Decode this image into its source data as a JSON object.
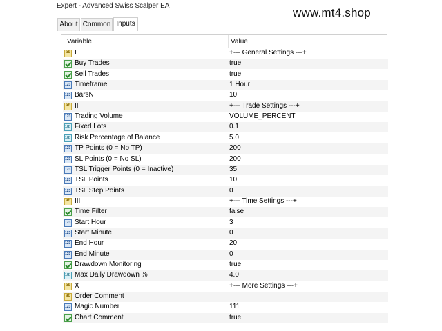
{
  "window": {
    "title": "Expert - Advanced Swiss Scalper EA"
  },
  "watermark": "www.mt4.shop",
  "tabs": [
    {
      "label": "About"
    },
    {
      "label": "Common"
    },
    {
      "label": "Inputs"
    }
  ],
  "table": {
    "headers": {
      "variable": "Variable",
      "value": "Value"
    },
    "rows": [
      {
        "icon": "ab",
        "name": "I",
        "value": "+--- General Settings ---+"
      },
      {
        "icon": "bool",
        "name": "Buy Trades",
        "value": "true"
      },
      {
        "icon": "bool",
        "name": "Sell Trades",
        "value": "true"
      },
      {
        "icon": "int",
        "name": "Timeframe",
        "value": "1 Hour"
      },
      {
        "icon": "int",
        "name": "BarsN",
        "value": "10"
      },
      {
        "icon": "ab",
        "name": "II",
        "value": "+--- Trade Settings ---+"
      },
      {
        "icon": "int",
        "name": "Trading Volume",
        "value": "VOLUME_PERCENT"
      },
      {
        "icon": "dbl",
        "name": "Fixed Lots",
        "value": "0.1"
      },
      {
        "icon": "dbl",
        "name": "Risk Percentage of Balance",
        "value": "5.0"
      },
      {
        "icon": "int",
        "name": "TP Points (0 = No TP)",
        "value": "200"
      },
      {
        "icon": "int",
        "name": "SL Points (0 = No SL)",
        "value": "200"
      },
      {
        "icon": "int",
        "name": "TSL Trigger Points (0 = Inactive)",
        "value": "35"
      },
      {
        "icon": "int",
        "name": "TSL Points",
        "value": "10"
      },
      {
        "icon": "int",
        "name": "TSL Step Points",
        "value": "0"
      },
      {
        "icon": "ab",
        "name": "III",
        "value": "+--- Time Settings ---+"
      },
      {
        "icon": "bool",
        "name": "Time Filter",
        "value": "false"
      },
      {
        "icon": "int",
        "name": "Start Hour",
        "value": "3"
      },
      {
        "icon": "int",
        "name": "Start Minute",
        "value": "0"
      },
      {
        "icon": "int",
        "name": "End Hour",
        "value": "20"
      },
      {
        "icon": "int",
        "name": "End Minute",
        "value": "0"
      },
      {
        "icon": "bool",
        "name": "Drawdown Monitoring",
        "value": "true"
      },
      {
        "icon": "dbl",
        "name": "Max Daily Drawdown %",
        "value": "4.0"
      },
      {
        "icon": "ab",
        "name": "X",
        "value": "+--- More Settings ---+"
      },
      {
        "icon": "ab",
        "name": "Order Comment",
        "value": ""
      },
      {
        "icon": "int",
        "name": "Magic Number",
        "value": "111"
      },
      {
        "icon": "bool",
        "name": "Chart Comment",
        "value": "true"
      }
    ]
  }
}
